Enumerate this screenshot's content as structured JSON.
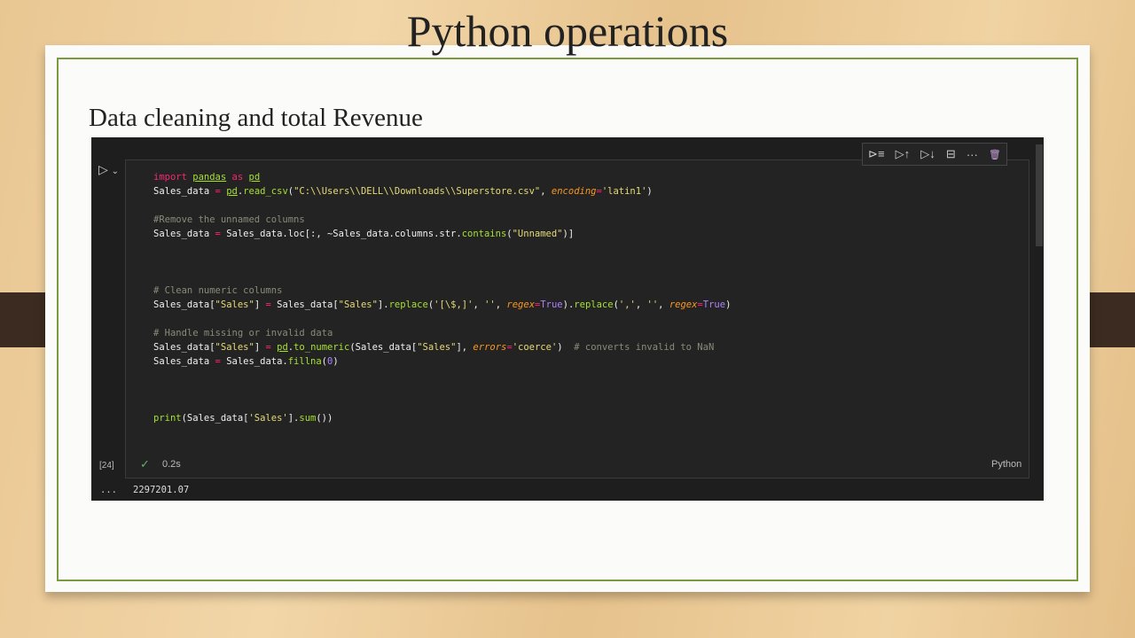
{
  "slide": {
    "title": "Python operations",
    "subtitle": "Data cleaning and total Revenue"
  },
  "cell": {
    "toolbar": [
      {
        "icon": "execute-above-icon",
        "glyph": "⊳≡"
      },
      {
        "icon": "run-above-icon",
        "glyph": "▷↑"
      },
      {
        "icon": "run-below-icon",
        "glyph": "▷↓"
      },
      {
        "icon": "split-cell-icon",
        "glyph": "⊟"
      },
      {
        "icon": "more-icon",
        "glyph": "···"
      },
      {
        "icon": "delete-icon",
        "glyph": "🗑"
      }
    ],
    "code_lines": [
      [
        [
          "import",
          "k"
        ],
        [
          " ",
          ""
        ],
        [
          "pandas",
          "m"
        ],
        [
          " as ",
          "k"
        ],
        [
          "pd",
          "m"
        ]
      ],
      [
        [
          "Sales_data ",
          ""
        ],
        [
          "=",
          "o"
        ],
        [
          " ",
          ""
        ],
        [
          "pd",
          "m"
        ],
        [
          ".",
          ""
        ],
        [
          "read_csv",
          "f"
        ],
        [
          "(",
          ""
        ],
        [
          "\"C:\\\\Users\\\\DELL\\\\Downloads\\\\Superstore.csv\"",
          "s"
        ],
        [
          ", ",
          ""
        ],
        [
          "encoding",
          "p"
        ],
        [
          "=",
          "o"
        ],
        [
          "'latin1'",
          "s"
        ],
        [
          ")",
          ""
        ]
      ],
      [],
      [
        [
          "#Remove the unnamed columns",
          "c"
        ]
      ],
      [
        [
          "Sales_data ",
          ""
        ],
        [
          "=",
          "o"
        ],
        [
          " Sales_data.loc[:, ~Sales_data.columns.str.",
          ""
        ],
        [
          "contains",
          "f"
        ],
        [
          "(",
          ""
        ],
        [
          "\"Unnamed\"",
          "s"
        ],
        [
          ")]",
          ""
        ]
      ],
      [],
      [],
      [],
      [
        [
          "# Clean numeric columns",
          "c"
        ]
      ],
      [
        [
          "Sales_data[",
          ""
        ],
        [
          "\"Sales\"",
          "s"
        ],
        [
          "] ",
          ""
        ],
        [
          "=",
          "o"
        ],
        [
          " Sales_data[",
          ""
        ],
        [
          "\"Sales\"",
          "s"
        ],
        [
          "].",
          ""
        ],
        [
          "replace",
          "f"
        ],
        [
          "(",
          ""
        ],
        [
          "'[\\$,]'",
          "s"
        ],
        [
          ", ",
          ""
        ],
        [
          "''",
          "s"
        ],
        [
          ", ",
          ""
        ],
        [
          "regex",
          "p"
        ],
        [
          "=",
          "o"
        ],
        [
          "True",
          "n"
        ],
        [
          ").",
          ""
        ],
        [
          "replace",
          "f"
        ],
        [
          "(",
          ""
        ],
        [
          "','",
          "s"
        ],
        [
          ", ",
          ""
        ],
        [
          "''",
          "s"
        ],
        [
          ", ",
          ""
        ],
        [
          "regex",
          "p"
        ],
        [
          "=",
          "o"
        ],
        [
          "True",
          "n"
        ],
        [
          ")",
          ""
        ]
      ],
      [],
      [
        [
          "# Handle missing or invalid data",
          "c"
        ]
      ],
      [
        [
          "Sales_data[",
          ""
        ],
        [
          "\"Sales\"",
          "s"
        ],
        [
          "] ",
          ""
        ],
        [
          "=",
          "o"
        ],
        [
          " ",
          ""
        ],
        [
          "pd",
          "m"
        ],
        [
          ".",
          ""
        ],
        [
          "to_numeric",
          "f"
        ],
        [
          "(Sales_data[",
          ""
        ],
        [
          "\"Sales\"",
          "s"
        ],
        [
          "], ",
          ""
        ],
        [
          "errors",
          "p"
        ],
        [
          "=",
          "o"
        ],
        [
          "'coerce'",
          "s"
        ],
        [
          ")  ",
          ""
        ],
        [
          "# converts invalid to NaN",
          "c"
        ]
      ],
      [
        [
          "Sales_data ",
          ""
        ],
        [
          "=",
          "o"
        ],
        [
          " Sales_data.",
          ""
        ],
        [
          "fillna",
          "f"
        ],
        [
          "(",
          ""
        ],
        [
          "0",
          "n"
        ],
        [
          ")",
          ""
        ]
      ],
      [],
      [],
      [],
      [
        [
          "print",
          "f"
        ],
        [
          "(Sales_data[",
          ""
        ],
        [
          "'Sales'",
          "s"
        ],
        [
          "].",
          ""
        ],
        [
          "sum",
          "f"
        ],
        [
          "())",
          ""
        ]
      ]
    ],
    "execution_count": "[24]",
    "status_icon": "check-icon",
    "duration": "0.2s",
    "language": "Python",
    "output_menu": "...",
    "output": "2297201.07"
  }
}
